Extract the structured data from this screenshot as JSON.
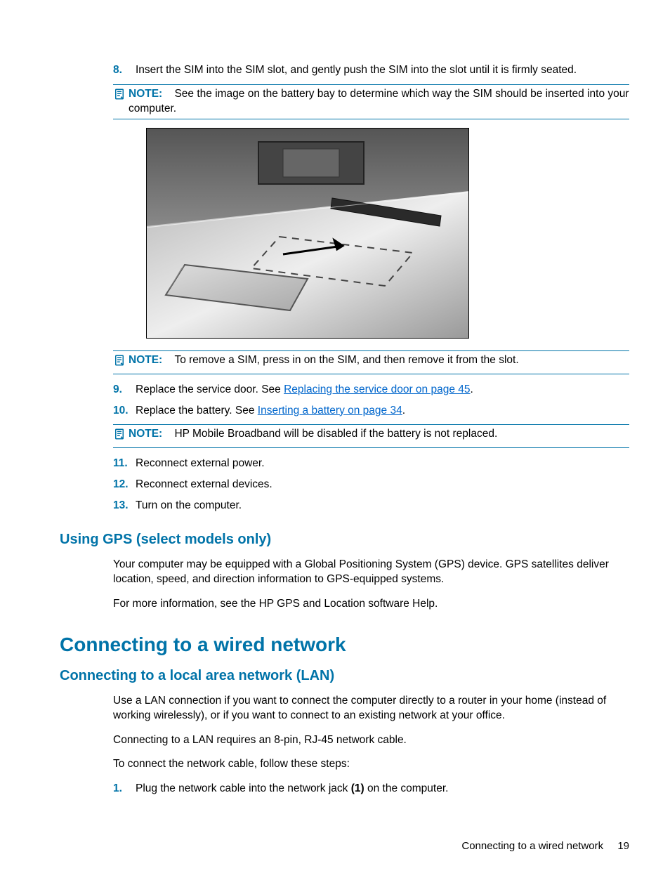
{
  "steps": {
    "s8": {
      "num": "8.",
      "text": "Insert the SIM into the SIM slot, and gently push the SIM into the slot until it is firmly seated."
    },
    "s9": {
      "num": "9.",
      "pre": "Replace the service door. See ",
      "link": "Replacing the service door on page 45",
      "post": "."
    },
    "s10": {
      "num": "10.",
      "pre": "Replace the battery. See ",
      "link": "Inserting a battery on page 34",
      "post": "."
    },
    "s11": {
      "num": "11.",
      "text": "Reconnect external power."
    },
    "s12": {
      "num": "12.",
      "text": "Reconnect external devices."
    },
    "s13": {
      "num": "13.",
      "text": "Turn on the computer."
    }
  },
  "notes": {
    "label": "NOTE:",
    "n1": "See the image on the battery bay to determine which way the SIM should be inserted into your computer.",
    "n2": "To remove a SIM, press in on the SIM, and then remove it from the slot.",
    "n3": "HP Mobile Broadband will be disabled if the battery is not replaced."
  },
  "headings": {
    "gps": "Using GPS (select models only)",
    "wired": "Connecting to a wired network",
    "lan": "Connecting to a local area network (LAN)"
  },
  "paras": {
    "gps1": "Your computer may be equipped with a Global Positioning System (GPS) device. GPS satellites deliver location, speed, and direction information to GPS-equipped systems.",
    "gps2": "For more information, see the HP GPS and Location software Help.",
    "lan1": "Use a LAN connection if you want to connect the computer directly to a router in your home (instead of working wirelessly), or if you want to connect to an existing network at your office.",
    "lan2": "Connecting to a LAN requires an 8-pin, RJ-45 network cable.",
    "lan3": "To connect the network cable, follow these steps:"
  },
  "lansteps": {
    "s1": {
      "num": "1.",
      "pre": "Plug the network cable into the network jack ",
      "bold": "(1)",
      "post": " on the computer."
    }
  },
  "footer": {
    "label": "Connecting to a wired network",
    "page": "19"
  }
}
